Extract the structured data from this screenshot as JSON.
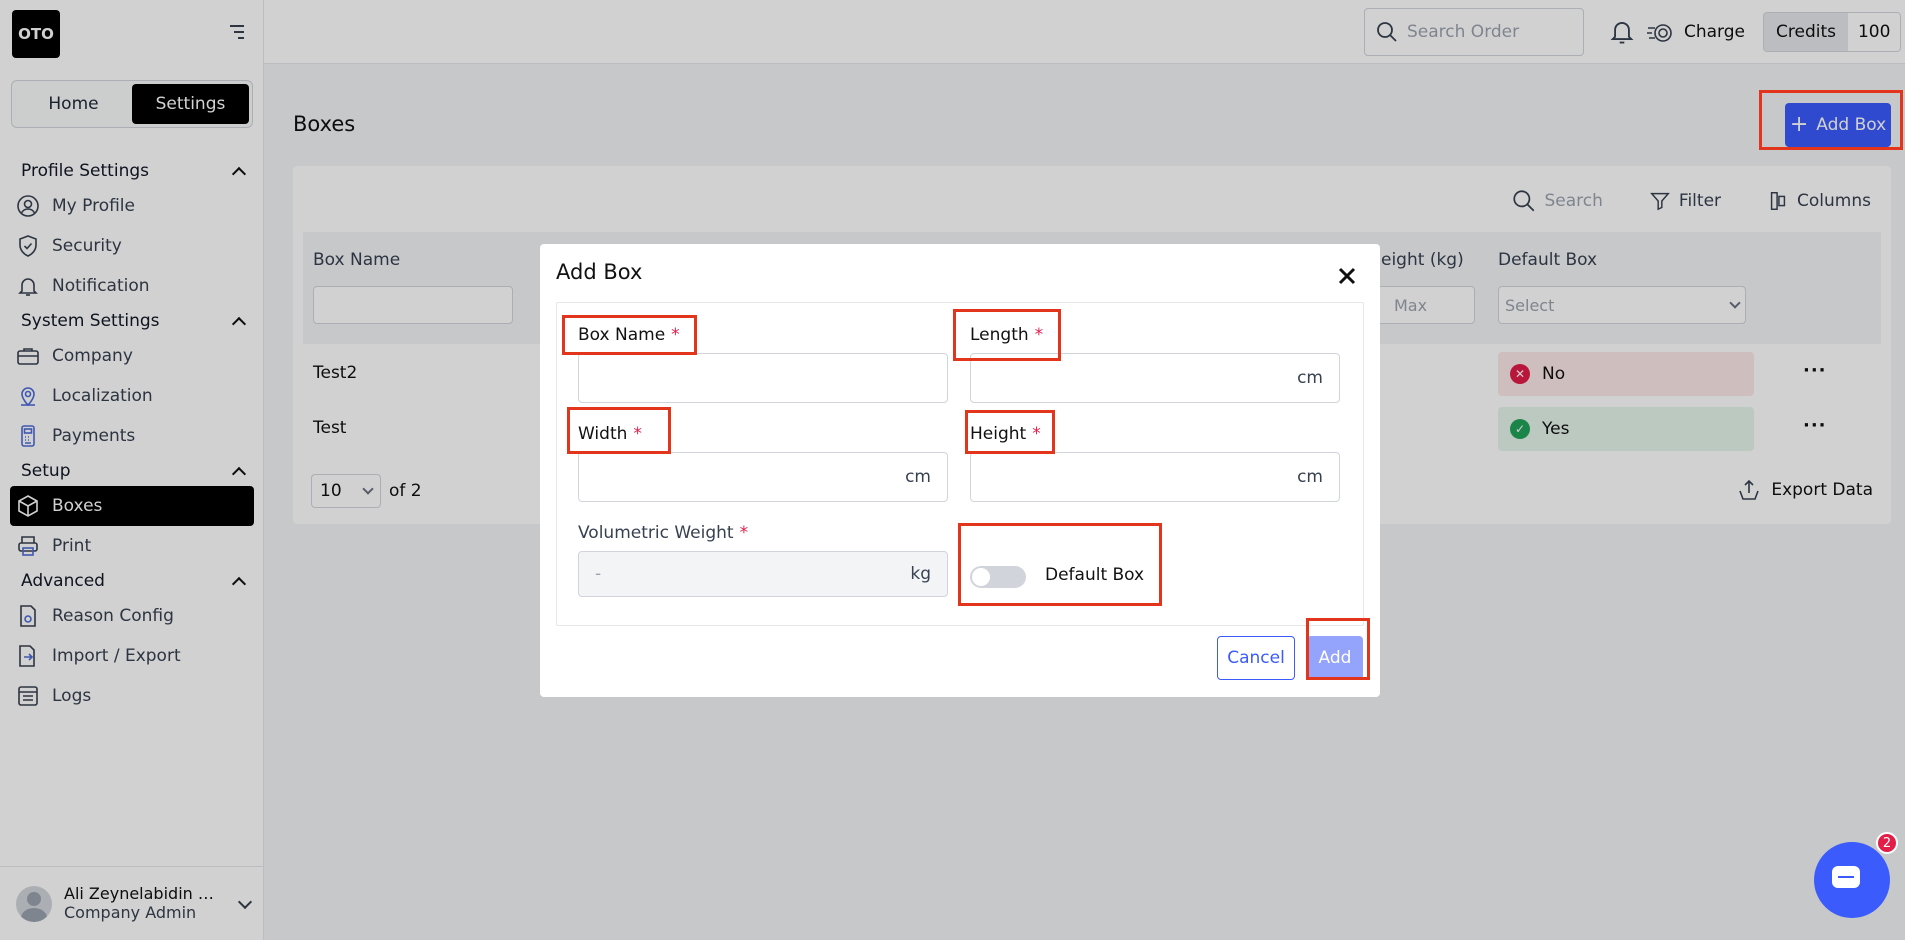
{
  "sidebar": {
    "logo": "OTO",
    "tabs": {
      "home": "Home",
      "settings": "Settings"
    },
    "sections": [
      {
        "title": "Profile Settings",
        "items": [
          "My Profile",
          "Security",
          "Notification"
        ]
      },
      {
        "title": "System Settings",
        "items": [
          "Company",
          "Localization",
          "Payments"
        ]
      },
      {
        "title": "Setup",
        "items": [
          "Boxes",
          "Print"
        ]
      },
      {
        "title": "Advanced",
        "items": [
          "Reason Config",
          "Import / Export",
          "Logs"
        ]
      }
    ],
    "active_item": "Boxes",
    "user": {
      "name": "Ali Zeynelabidin U...",
      "role": "Company Admin"
    }
  },
  "header": {
    "search_placeholder": "Search Order",
    "charge_label": "Charge",
    "credits_label": "Credits",
    "credits_value": "100"
  },
  "page": {
    "title": "Boxes",
    "add_button": "Add Box",
    "toolbar": {
      "search": "Search",
      "filter": "Filter",
      "columns": "Columns"
    },
    "columns": {
      "box_name": "Box Name",
      "weight": "eight (kg)",
      "default_box": "Default Box"
    },
    "filters": {
      "max_placeholder": "Max",
      "select_placeholder": "Select"
    },
    "rows": [
      {
        "name": "Test2",
        "default": "No"
      },
      {
        "name": "Test",
        "default": "Yes"
      }
    ],
    "pager": {
      "page_size": "10",
      "of_text": "of 2"
    },
    "export_label": "Export Data"
  },
  "modal": {
    "title": "Add Box",
    "fields": {
      "box_name": "Box Name",
      "length": "Length",
      "width": "Width",
      "height": "Height",
      "volumetric_weight": "Volumetric Weight"
    },
    "required_mark": "*",
    "unit_cm": "cm",
    "unit_kg": "kg",
    "volumetric_value": "-",
    "default_box_toggle": "Default Box",
    "default_box_on": false,
    "cancel": "Cancel",
    "add": "Add"
  },
  "chat": {
    "badge": "2"
  },
  "colors": {
    "accent": "#3b5bfd",
    "highlight": "#e3341c",
    "error": "#e11d48",
    "success": "#22a35a"
  }
}
